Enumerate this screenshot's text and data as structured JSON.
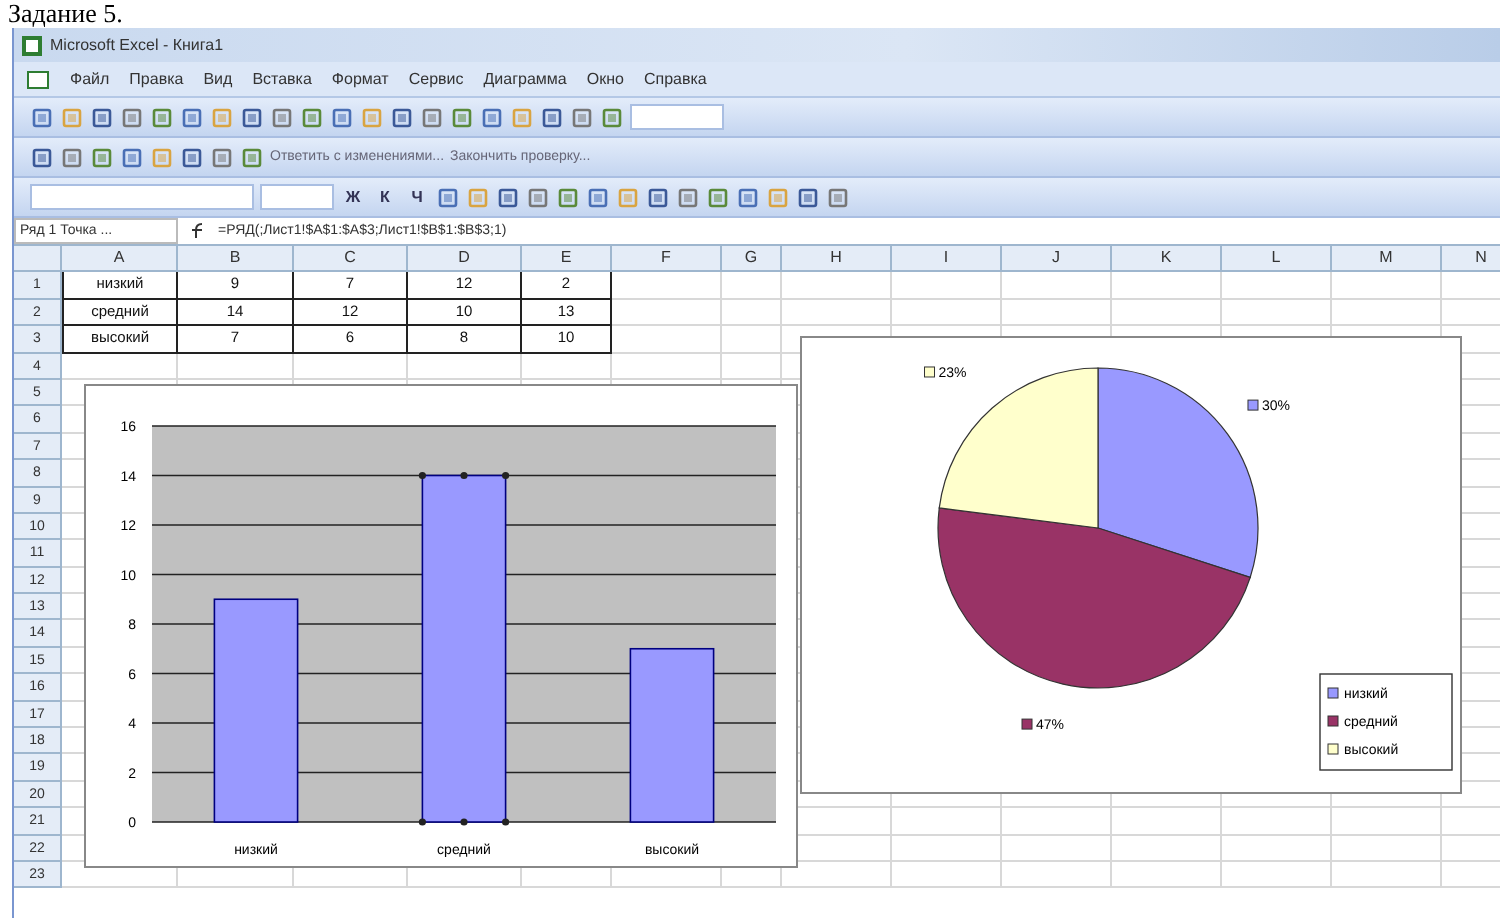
{
  "caption": "Задание 5.",
  "window": {
    "title": "Microsoft Excel - Книга1"
  },
  "menu": [
    "Файл",
    "Правка",
    "Вид",
    "Вставка",
    "Формат",
    "Сервис",
    "Диаграмма",
    "Окно",
    "Справка"
  ],
  "reviewing_toolbar": {
    "reply": "Ответить с изменениями...",
    "finish": "Закончить проверку..."
  },
  "format_toolbar": {
    "style_buttons": [
      "Ж",
      "К",
      "Ч"
    ]
  },
  "formula_bar": {
    "name_box": "Ряд 1 Точка ...",
    "formula": "=РЯД(;Лист1!$A$1:$A$3;Лист1!$B$1:$B$3;1)"
  },
  "sheet": {
    "columns": [
      "A",
      "B",
      "C",
      "D",
      "E",
      "F",
      "G",
      "H",
      "I",
      "J",
      "K",
      "L",
      "M",
      "N"
    ],
    "rows": [
      "1",
      "2",
      "3",
      "4",
      "5",
      "6",
      "7",
      "8",
      "9",
      "10",
      "11",
      "12",
      "13",
      "14",
      "15",
      "16",
      "17",
      "18",
      "19",
      "20",
      "21",
      "22",
      "23"
    ],
    "cells": [
      [
        "низкий",
        "9",
        "7",
        "12",
        "2"
      ],
      [
        "средний",
        "14",
        "12",
        "10",
        "13"
      ],
      [
        "высокий",
        "7",
        "6",
        "8",
        "10"
      ]
    ]
  },
  "bar_chart": {
    "points": [
      {
        "selected": false
      },
      {
        "selected": true
      },
      {
        "selected": false
      }
    ],
    "chart_data": {
      "type": "bar",
      "categories": [
        "низкий",
        "средний",
        "высокий"
      ],
      "values": [
        9,
        14,
        7
      ],
      "ylim": [
        0,
        16
      ],
      "yticks": [
        0,
        2,
        4,
        6,
        8,
        10,
        12,
        14,
        16
      ],
      "grid": true
    }
  },
  "pie_chart": {
    "slices": [
      {
        "color": "#9999ff"
      },
      {
        "color": "#993366"
      },
      {
        "color": "#ffffcc"
      }
    ],
    "chart_data": {
      "type": "pie",
      "categories": [
        "низкий",
        "средний",
        "высокий"
      ],
      "values": [
        30,
        47,
        23
      ],
      "value_labels": [
        "30%",
        "47%",
        "23%"
      ],
      "legend": "right"
    }
  }
}
